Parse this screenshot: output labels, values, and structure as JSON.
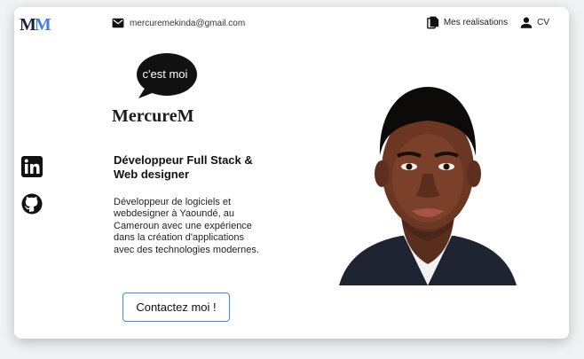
{
  "header": {
    "logo_first": "M",
    "logo_second": "M",
    "email": "mercuremekinda@gmail.com",
    "nav": [
      {
        "label": "Mes realisations",
        "icon": "document-copy-icon"
      },
      {
        "label": "CV",
        "icon": "person-icon"
      }
    ]
  },
  "hero": {
    "bubble_text": "c'est moi",
    "brand": "MercureM",
    "headline": "Développeur Full Stack & Web designer",
    "description": "Développeur de logiciels et webdesigner à Yaoundé, au Cameroun avec une expérience dans la création d'applications avec des technologies modernes.",
    "cta_label": "Contactez moi !"
  },
  "social": [
    {
      "icon": "linkedin-icon"
    },
    {
      "icon": "github-icon"
    }
  ],
  "colors": {
    "accent": "#3a8fe3",
    "logo_dark": "#1a1f3c",
    "logo_blue": "#3e7ff0",
    "text": "#111111"
  }
}
